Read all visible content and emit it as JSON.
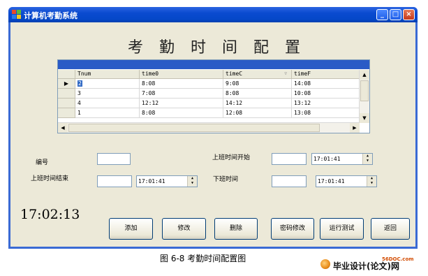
{
  "window": {
    "title": "计算机考勤系统",
    "controls": {
      "minimize": "_",
      "maximize": "□",
      "close": "×"
    }
  },
  "heading": "考勤时间配置",
  "grid": {
    "columns": [
      "Tnum",
      "time0",
      "timeC",
      "timeF"
    ],
    "sort_glyph": "▽",
    "rows": [
      {
        "Tnum": "2",
        "time0": "8:08",
        "timeC": "9:08",
        "timeF": "14:08",
        "current": true
      },
      {
        "Tnum": "3",
        "time0": "7:08",
        "timeC": "8:08",
        "timeF": "10:08"
      },
      {
        "Tnum": "4",
        "time0": "12:12",
        "timeC": "14:12",
        "timeF": "13:12"
      },
      {
        "Tnum": "1",
        "time0": "8:08",
        "timeC": "12:08",
        "timeF": "13:08"
      }
    ],
    "current_row_marker": "▶"
  },
  "form": {
    "id_label": "编号",
    "id_value": "",
    "work_start_label": "上班时间开始",
    "work_start_text": "",
    "work_start_time": "17:01:41",
    "work_end_label": "上班时间结束",
    "work_end_text": "",
    "work_end_time": "17:01:41",
    "off_label": "下班时间",
    "off_text": "",
    "off_time": "17:01:41"
  },
  "clock": "17:02:13",
  "buttons": {
    "add": "添加",
    "edit": "修改",
    "delete": "删除",
    "password": "密码修改",
    "test": "运行测试",
    "back": "返回"
  },
  "caption": "图 6-8 考勤时间配置图",
  "watermark": {
    "site": "56DOC.com",
    "text": "毕业设计(论文)网"
  },
  "colors": {
    "titlebar": "#0a4ad0",
    "client_bg": "#ece9d8",
    "grid_band": "#2a5bc6",
    "selection": "#316ac5"
  }
}
